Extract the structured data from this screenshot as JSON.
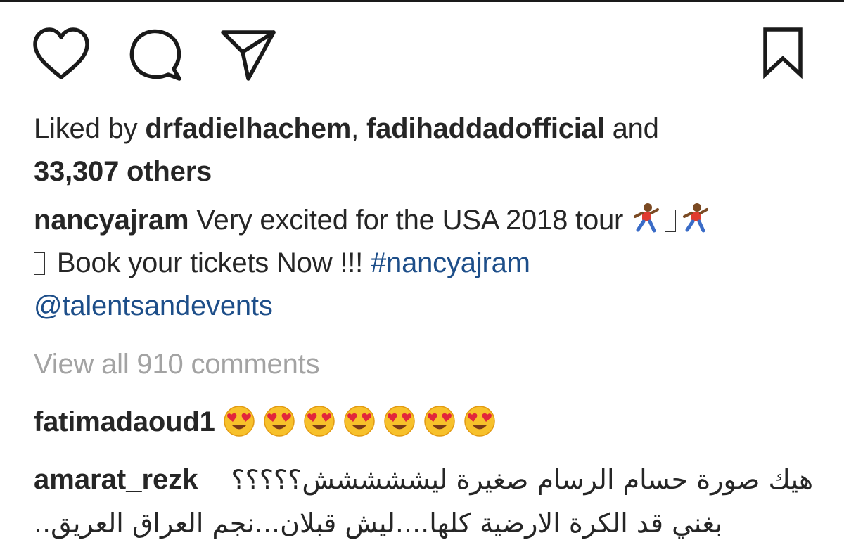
{
  "actions": {
    "like_icon": "heart-outline-icon",
    "comment_icon": "speech-bubble-icon",
    "share_icon": "paper-plane-icon",
    "save_icon": "bookmark-outline-icon"
  },
  "likes": {
    "prefix": "Liked by ",
    "user1": "drfadielhachem",
    "separator": ", ",
    "user2": "fadihaddadofficial",
    "conjunction": " and",
    "others": "33,307 others"
  },
  "caption": {
    "username": "nancyajram",
    "text1": " Very excited for the USA 2018 tour ",
    "text2": " Book your tickets Now !!! ",
    "hashtag": "#nancyajram",
    "mention": "@talentsandevents"
  },
  "view_all_comments": "View all 910 comments",
  "comments": [
    {
      "username": "fatimadaoud1",
      "emoji": "heart-eyes-face-icon",
      "emoji_count": 7
    },
    {
      "username": "amarat_rezk",
      "line1": "هيك صورة حسام الرسام صغيرة ليششششش؟؟؟؟؟",
      "line2": "بغني قد الكرة الارضية كلها....ليش قبلان...نجم العراق العريق.."
    }
  ],
  "colors": {
    "text": "#262626",
    "link": "#1d4e89",
    "muted": "#a3a3a3"
  }
}
